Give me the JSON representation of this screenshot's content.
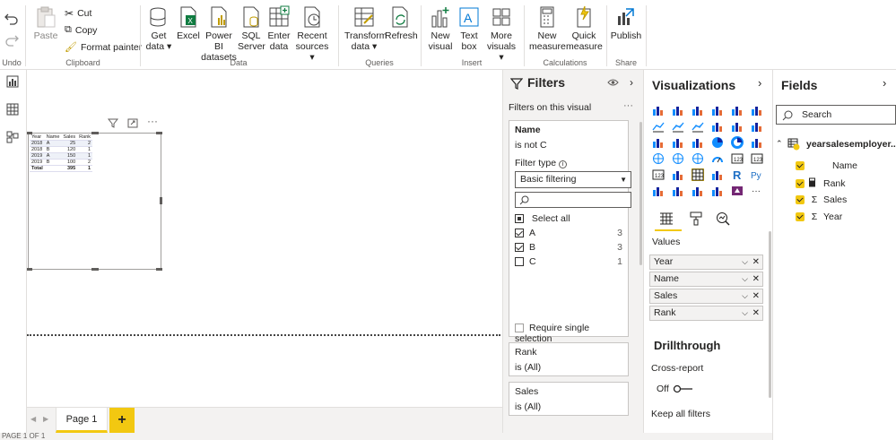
{
  "ribbon": {
    "undo": "Undo",
    "clipboard": {
      "paste": "Paste",
      "cut": "Cut",
      "copy": "Copy",
      "format_painter": "Format painter",
      "group": "Clipboard"
    },
    "data": {
      "get_data": "Get",
      "get_data2": "data",
      "excel": "Excel",
      "powerbi": "Power BI",
      "powerbi2": "datasets",
      "sql": "SQL",
      "sql2": "Server",
      "enter": "Enter",
      "enter2": "data",
      "recent": "Recent",
      "recent2": "sources",
      "group": "Data"
    },
    "queries": {
      "transform": "Transform",
      "transform2": "data",
      "refresh": "Refresh",
      "group": "Queries"
    },
    "insert": {
      "new_visual": "New",
      "new_visual2": "visual",
      "text_box": "Text",
      "text_box2": "box",
      "more": "More",
      "more2": "visuals",
      "group": "Insert"
    },
    "calculations": {
      "new_measure": "New",
      "new_measure2": "measure",
      "quick": "Quick",
      "quick2": "measure",
      "group": "Calculations"
    },
    "share": {
      "publish": "Publish",
      "group": "Share"
    }
  },
  "table_visual": {
    "headers": [
      "Year",
      "Name",
      "Sales",
      "Rank"
    ],
    "rows": [
      [
        "2018",
        "A",
        "25",
        "2"
      ],
      [
        "2018",
        "B",
        "120",
        "1"
      ],
      [
        "2019",
        "A",
        "150",
        "1"
      ],
      [
        "2019",
        "B",
        "100",
        "2"
      ]
    ],
    "total": [
      "Total",
      "",
      "395",
      "1"
    ]
  },
  "pages": {
    "page1": "Page 1",
    "add": "+"
  },
  "status": "PAGE 1 OF 1",
  "filters": {
    "title": "Filters",
    "section": "Filters on this visual",
    "name_card": {
      "field": "Name",
      "summary": "is not C",
      "filter_type_label": "Filter type",
      "filter_type_value": "Basic filtering",
      "select_all": "Select all",
      "items": [
        {
          "label": "A",
          "count": "3",
          "checked": true
        },
        {
          "label": "B",
          "count": "3",
          "checked": true
        },
        {
          "label": "C",
          "count": "1",
          "checked": false
        }
      ],
      "require_single": "Require single selection"
    },
    "rank_card": {
      "field": "Rank",
      "summary": "is (All)"
    },
    "sales_card": {
      "field": "Sales",
      "summary": "is (All)"
    }
  },
  "visualizations": {
    "title": "Visualizations",
    "values_label": "Values",
    "wells": [
      "Year",
      "Name",
      "Sales",
      "Rank"
    ],
    "drillthrough": "Drillthrough",
    "cross_report": "Cross-report",
    "off": "Off",
    "keep_filters": "Keep all filters"
  },
  "fields": {
    "title": "Fields",
    "search_placeholder": "Search",
    "table_name": "yearsalesemployer...",
    "items": [
      {
        "name": "Name",
        "type": ""
      },
      {
        "name": "Rank",
        "type": "calc"
      },
      {
        "name": "Sales",
        "type": "Σ"
      },
      {
        "name": "Year",
        "type": "Σ"
      }
    ]
  },
  "colors": {
    "accent": "#f2c811",
    "chart_blue": "#118dff"
  }
}
